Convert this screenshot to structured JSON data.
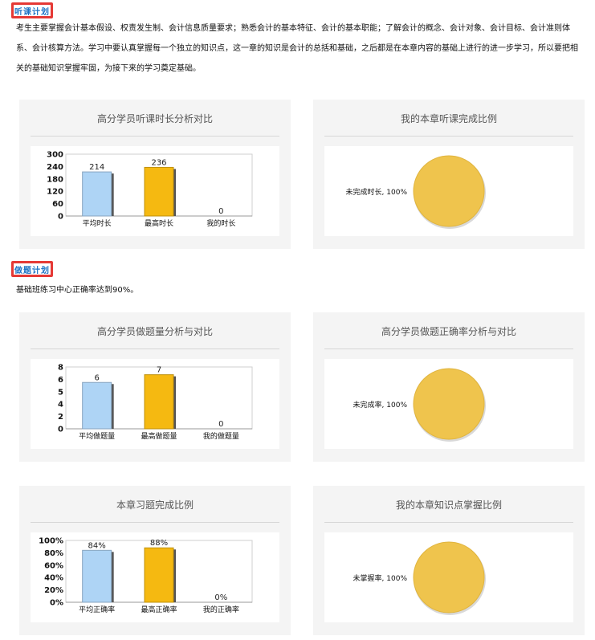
{
  "sections": {
    "listen": {
      "tag": "听课计划",
      "text": "考生主要掌握会计基本假设、权责发生制、会计信息质量要求；熟悉会计的基本特征、会计的基本职能；了解会计的概念、会计对象、会计目标、会计准则体系、会计核算方法。学习中要认真掌握每一个独立的知识点，这一章的知识是会计的总括和基础，之后都是在本章内容的基础上进行的进一步学习，所以要把相关的基础知识掌握牢固，为接下来的学习奠定基础。"
    },
    "practice": {
      "tag": "做题计划",
      "text": "基础班练习中心正确率达到90%。"
    }
  },
  "panels": {
    "p1": {
      "title": "高分学员听课时长分析对比"
    },
    "p2": {
      "title": "我的本章听课完成比例"
    },
    "p3": {
      "title": "高分学员做题量分析与对比"
    },
    "p4": {
      "title": "高分学员做题正确率分析与对比"
    },
    "p5": {
      "title": "本章习题完成比例"
    },
    "p6": {
      "title": "我的本章知识点掌握比例"
    }
  },
  "colors": {
    "blue": "#aed4f5",
    "orange": "#f5b911",
    "pie": "#efc44d",
    "tag_border": "#e53935",
    "tag_text": "#1f74c5"
  },
  "chart_data": [
    {
      "type": "bar",
      "categories": [
        "平均时长",
        "最高时长",
        "我的时长"
      ],
      "values": [
        214,
        236,
        0
      ],
      "value_labels": [
        "214",
        "236",
        "0"
      ],
      "yticks": [
        "300",
        "240",
        "180",
        "120",
        "60",
        "0"
      ],
      "ylim": [
        0,
        300
      ],
      "colors": [
        "#aed4f5",
        "#f5b911",
        "#aed4f5"
      ]
    },
    {
      "type": "pie",
      "slices": [
        {
          "label": "未完成时长, 100%",
          "value": 100
        }
      ]
    },
    {
      "type": "bar",
      "categories": [
        "平均做题量",
        "最高做题量",
        "我的做题量"
      ],
      "values": [
        6,
        7,
        0
      ],
      "value_labels": [
        "6",
        "7",
        "0"
      ],
      "yticks": [
        "8",
        "6",
        "5",
        "4",
        "2",
        "0"
      ],
      "ylim": [
        0,
        8
      ],
      "colors": [
        "#aed4f5",
        "#f5b911",
        "#aed4f5"
      ]
    },
    {
      "type": "pie",
      "slices": [
        {
          "label": "未完成率, 100%",
          "value": 100
        }
      ]
    },
    {
      "type": "bar",
      "categories": [
        "平均正确率",
        "最高正确率",
        "我的正确率"
      ],
      "values": [
        84,
        88,
        0
      ],
      "value_labels": [
        "84%",
        "88%",
        "0%"
      ],
      "yticks": [
        "100%",
        "80%",
        "60%",
        "40%",
        "20%",
        "0%"
      ],
      "ylim": [
        0,
        100
      ],
      "colors": [
        "#aed4f5",
        "#f5b911",
        "#aed4f5"
      ]
    },
    {
      "type": "pie",
      "slices": [
        {
          "label": "未掌握率, 100%",
          "value": 100
        }
      ]
    }
  ]
}
